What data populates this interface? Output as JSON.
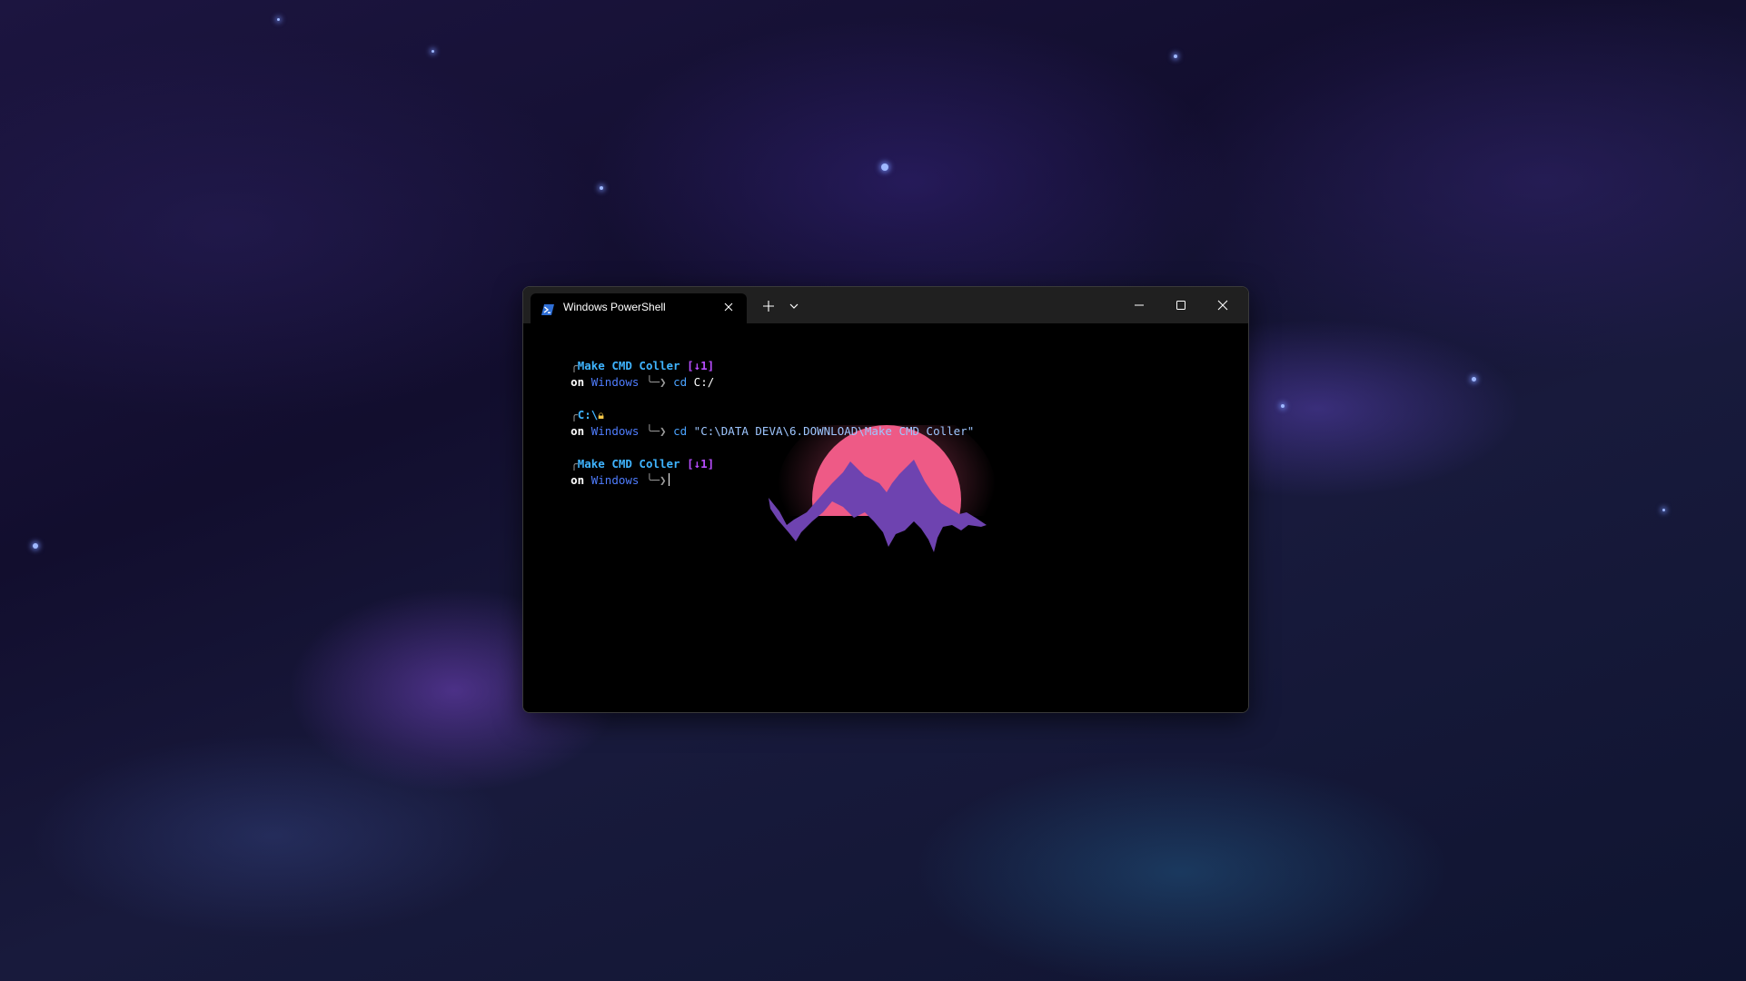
{
  "window": {
    "tab_title": "Windows PowerShell",
    "tab_icon": "powershell-icon",
    "buttons": {
      "new_tab_icon": "plus-icon",
      "dropdown_icon": "chevron-down-icon",
      "minimize_icon": "minimize-icon",
      "maximize_icon": "maximize-icon",
      "close_icon": "close-icon"
    }
  },
  "colors": {
    "path": "#3fb4ff",
    "host": "#4f7dff",
    "git_status": "#b84dff",
    "command": "#4aa3ff",
    "sun": "#ee5a86",
    "mountain": "#6e43b0"
  },
  "terminal": {
    "block1": {
      "corner": "╭",
      "path": "Make CMD Coller",
      "git": "[↓1]",
      "on": "on",
      "host": "Windows",
      "prompt": "╰─❯",
      "cmd": "cd",
      "args": "C:/"
    },
    "block2": {
      "corner": "╭",
      "path": "C:\\",
      "lock_icon": "lock-icon",
      "on": "on",
      "host": "Windows",
      "prompt": "╰─❯",
      "cmd": "cd",
      "args": "\"C:\\DATA DEVA\\6.DOWNLOAD\\Make CMD Coller\""
    },
    "block3": {
      "corner": "╭",
      "path": "Make CMD Coller",
      "git": "[↓1]",
      "on": "on",
      "host": "Windows",
      "prompt": "╰─❯"
    }
  }
}
